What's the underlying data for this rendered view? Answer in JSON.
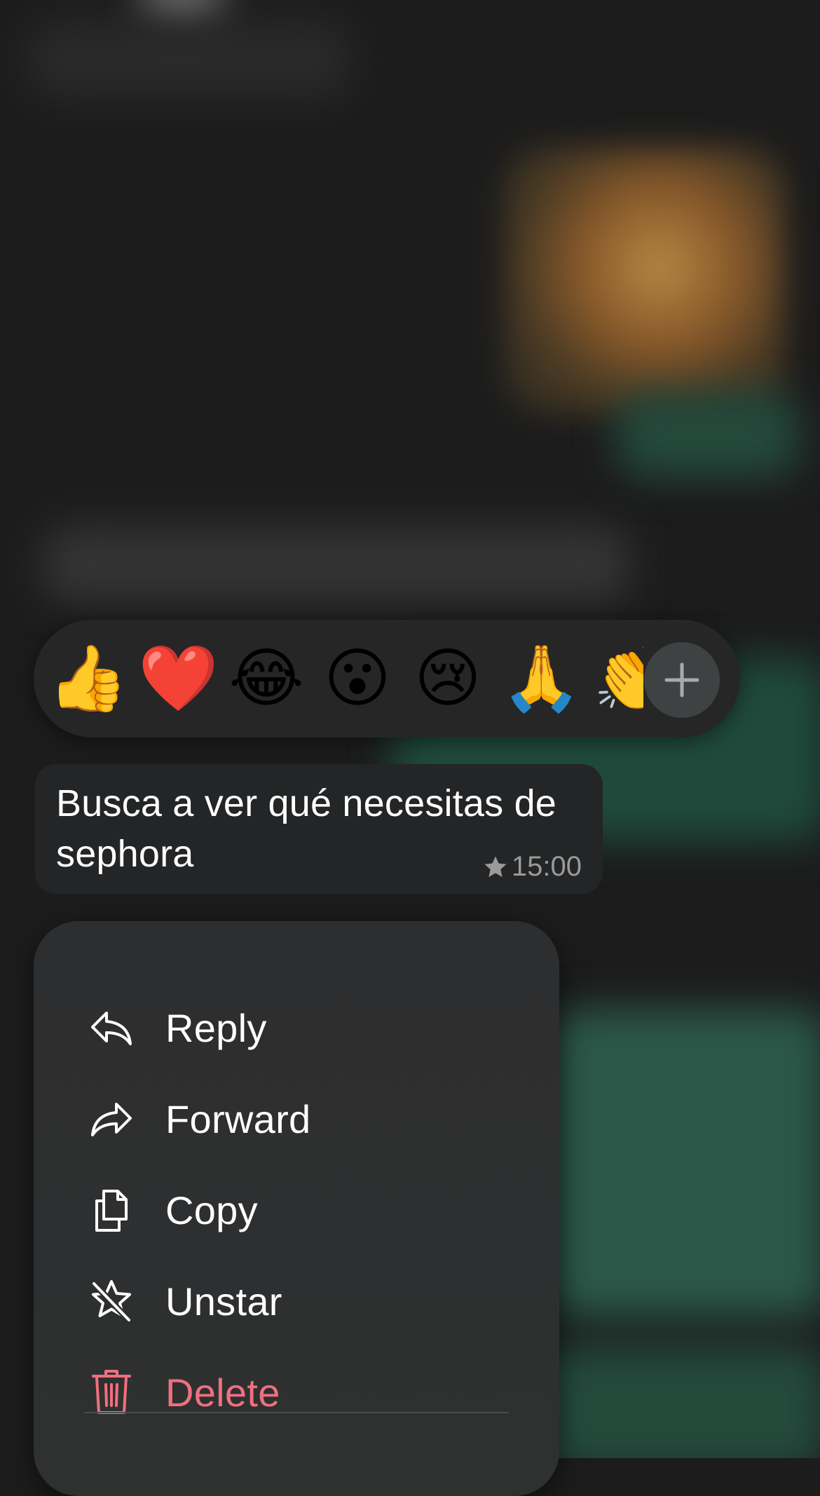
{
  "reactions": {
    "items": [
      {
        "name": "thumbs-up",
        "glyph": "👍"
      },
      {
        "name": "red-heart",
        "glyph": "❤️"
      },
      {
        "name": "tears-of-joy",
        "glyph": "😂"
      },
      {
        "name": "surprised",
        "glyph": "😮"
      },
      {
        "name": "crying",
        "glyph": "😢"
      },
      {
        "name": "folded-hands",
        "glyph": "🙏"
      },
      {
        "name": "clapping-hands",
        "glyph": "👏"
      }
    ],
    "more_icon": "plus-icon"
  },
  "message": {
    "text": "Busca a ver qué necesitas de sephora",
    "time": "15:00",
    "starred": true,
    "star_icon": "star-icon"
  },
  "menu": {
    "items": [
      {
        "label": "Reply",
        "icon": "reply-icon"
      },
      {
        "label": "Forward",
        "icon": "forward-icon"
      },
      {
        "label": "Copy",
        "icon": "copy-icon"
      },
      {
        "label": "Unstar",
        "icon": "unstar-icon"
      },
      {
        "label": "Delete",
        "icon": "trash-icon",
        "destructive": true
      }
    ]
  },
  "colors": {
    "destructive": "#f0707e",
    "bubble": "#242526",
    "menu": "#2e2f30"
  }
}
